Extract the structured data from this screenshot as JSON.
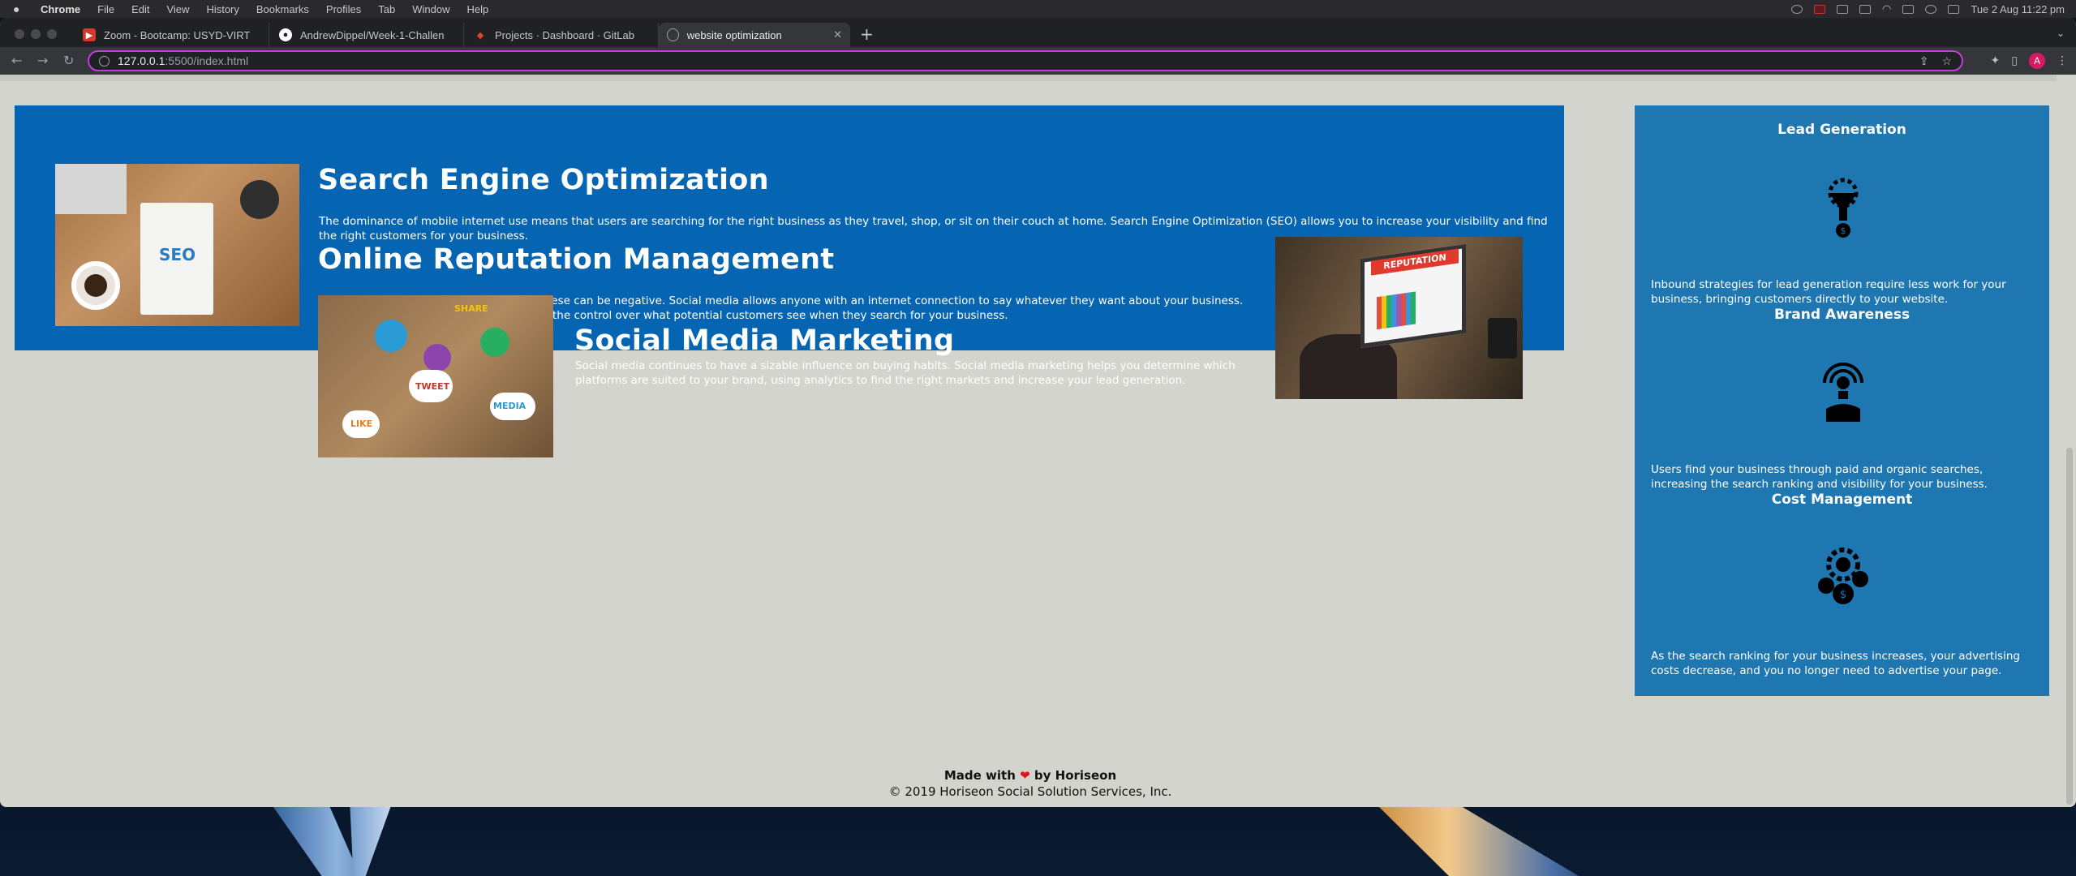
{
  "menubar": {
    "app_name": "Chrome",
    "items": [
      "File",
      "Edit",
      "View",
      "History",
      "Bookmarks",
      "Profiles",
      "Tab",
      "Window",
      "Help"
    ],
    "clock": "Tue 2 Aug  11:22 pm"
  },
  "browser": {
    "tabs": [
      {
        "title": "Zoom - Bootcamp: USYD-VIRT",
        "favicon": "zoom-icon",
        "color": "#d7372e"
      },
      {
        "title": "AndrewDippel/Week-1-Challen",
        "favicon": "github-icon",
        "color": "#ffffff"
      },
      {
        "title": "Projects · Dashboard · GitLab",
        "favicon": "gitlab-icon",
        "color": "#e24329"
      },
      {
        "title": "website optimization",
        "favicon": "globe-icon",
        "color": "#9aa0a6"
      }
    ],
    "url_host": "127.0.0.1",
    "url_path": ":5500/index.html",
    "avatar_letter": "A"
  },
  "page": {
    "sections": [
      {
        "title": "Search Engine Optimization",
        "text": "The dominance of mobile internet use means that users are searching for the right business as they travel, shop, or sit on their couch at home. Search Engine Optimization (SEO) allows you to increase your visibility and find the right customers for your business."
      },
      {
        "title": "Online Reputation Management",
        "text": "The web is full of opinions, and some of these can be negative. Social media allows anyone with an internet connection to say whatever they want about your business. Online Reputation Management gives you the control over what potential customers see when they search for your business."
      },
      {
        "title": "Social Media Marketing",
        "text": "Social media continues to have a sizable influence on buying habits. Social media marketing helps you determine which platforms are suited to your brand, using analytics to find the right markets and increase your lead generation."
      }
    ],
    "image_labels": {
      "seo": "SEO",
      "reputation": "REPUTATION",
      "share": "SHARE",
      "tweet": "TWEET",
      "like": "LIKE",
      "media": "MEDIA"
    },
    "benefits": [
      {
        "title": "Lead Generation",
        "icon": "lead-generation-icon",
        "text": "Inbound strategies for lead generation require less work for your business, bringing customers directly to your website."
      },
      {
        "title": "Brand Awareness",
        "icon": "brand-awareness-icon",
        "text": "Users find your business through paid and organic searches, increasing the search ranking and visibility for your business."
      },
      {
        "title": "Cost Management",
        "icon": "cost-management-icon",
        "text": "As the search ranking for your business increases, your advertising costs decrease, and you no longer need to advertise your page."
      }
    ],
    "footer": {
      "made_with": "Made with",
      "by": "by Horiseon",
      "copyright": "© 2019 Horiseon Social Solution Services, Inc."
    }
  },
  "colors": {
    "content_blue": "#0565b3",
    "sidebar_blue": "#1e77b1",
    "page_bg": "#d4d4ce",
    "omnibox_focus": "#c03fd8"
  }
}
